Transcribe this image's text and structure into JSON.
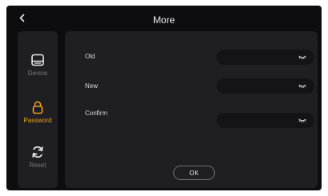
{
  "header": {
    "title": "More"
  },
  "sidebar": {
    "items": [
      {
        "label": "Device",
        "icon": "device-icon",
        "active": false
      },
      {
        "label": "Password",
        "icon": "lock-icon",
        "active": true
      },
      {
        "label": "Reset",
        "icon": "refresh-icon",
        "active": false
      }
    ]
  },
  "form": {
    "old_label": "Old",
    "new_label": "New",
    "confirm_label": "Confirm",
    "old_value": "",
    "new_value": "",
    "confirm_value": "",
    "ok_label": "OK"
  },
  "colors": {
    "accent": "#f0a019",
    "panel": "#1e1e23",
    "background": "#0d0d10",
    "inactive": "#7a7a80"
  }
}
